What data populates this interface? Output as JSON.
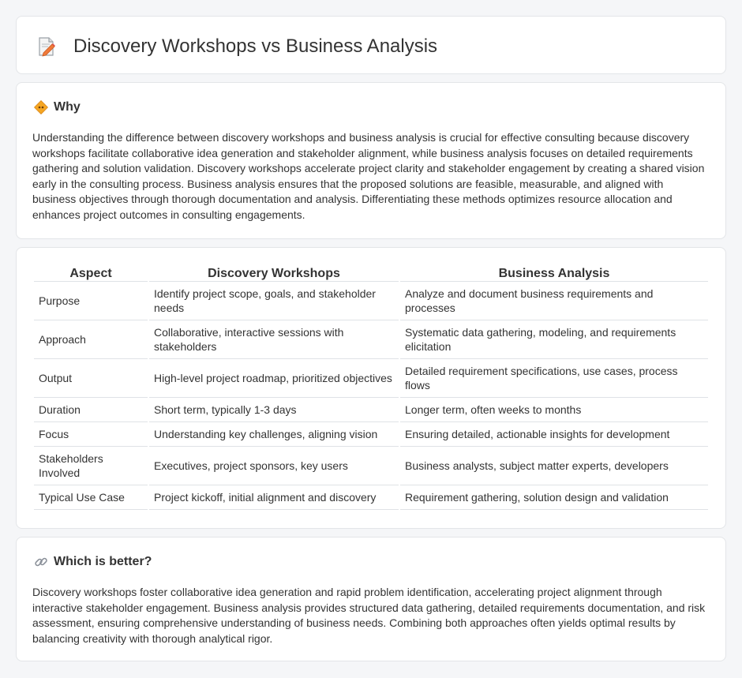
{
  "header": {
    "title": "Discovery Workshops vs Business Analysis",
    "icon": "document-pencil-icon"
  },
  "why": {
    "heading": "Why",
    "icon": "diamond-sign-icon",
    "body": "Understanding the difference between discovery workshops and business analysis is crucial for effective consulting because discovery workshops facilitate collaborative idea generation and stakeholder alignment, while business analysis focuses on detailed requirements gathering and solution validation. Discovery workshops accelerate project clarity and stakeholder engagement by creating a shared vision early in the consulting process. Business analysis ensures that the proposed solutions are feasible, measurable, and aligned with business objectives through thorough documentation and analysis. Differentiating these methods optimizes resource allocation and enhances project outcomes in consulting engagements."
  },
  "comparison": {
    "headers": [
      "Aspect",
      "Discovery Workshops",
      "Business Analysis"
    ],
    "rows": [
      [
        "Purpose",
        "Identify project scope, goals, and stakeholder needs",
        "Analyze and document business requirements and processes"
      ],
      [
        "Approach",
        "Collaborative, interactive sessions with stakeholders",
        "Systematic data gathering, modeling, and requirements elicitation"
      ],
      [
        "Output",
        "High-level project roadmap, prioritized objectives",
        "Detailed requirement specifications, use cases, process flows"
      ],
      [
        "Duration",
        "Short term, typically 1-3 days",
        "Longer term, often weeks to months"
      ],
      [
        "Focus",
        "Understanding key challenges, aligning vision",
        "Ensuring detailed, actionable insights for development"
      ],
      [
        "Stakeholders Involved",
        "Executives, project sponsors, key users",
        "Business analysts, subject matter experts, developers"
      ],
      [
        "Typical Use Case",
        "Project kickoff, initial alignment and discovery",
        "Requirement gathering, solution design and validation"
      ]
    ]
  },
  "better": {
    "heading": "Which is better?",
    "icon": "link-icon",
    "body": "Discovery workshops foster collaborative idea generation and rapid problem identification, accelerating project alignment through interactive stakeholder engagement. Business analysis provides structured data gathering, detailed requirements documentation, and risk assessment, ensuring comprehensive understanding of business needs. Combining both approaches often yields optimal results by balancing creativity with thorough analytical rigor."
  },
  "colors": {
    "accent": "#f0a030",
    "border": "#e3e5e8",
    "background": "#f5f6f8"
  }
}
